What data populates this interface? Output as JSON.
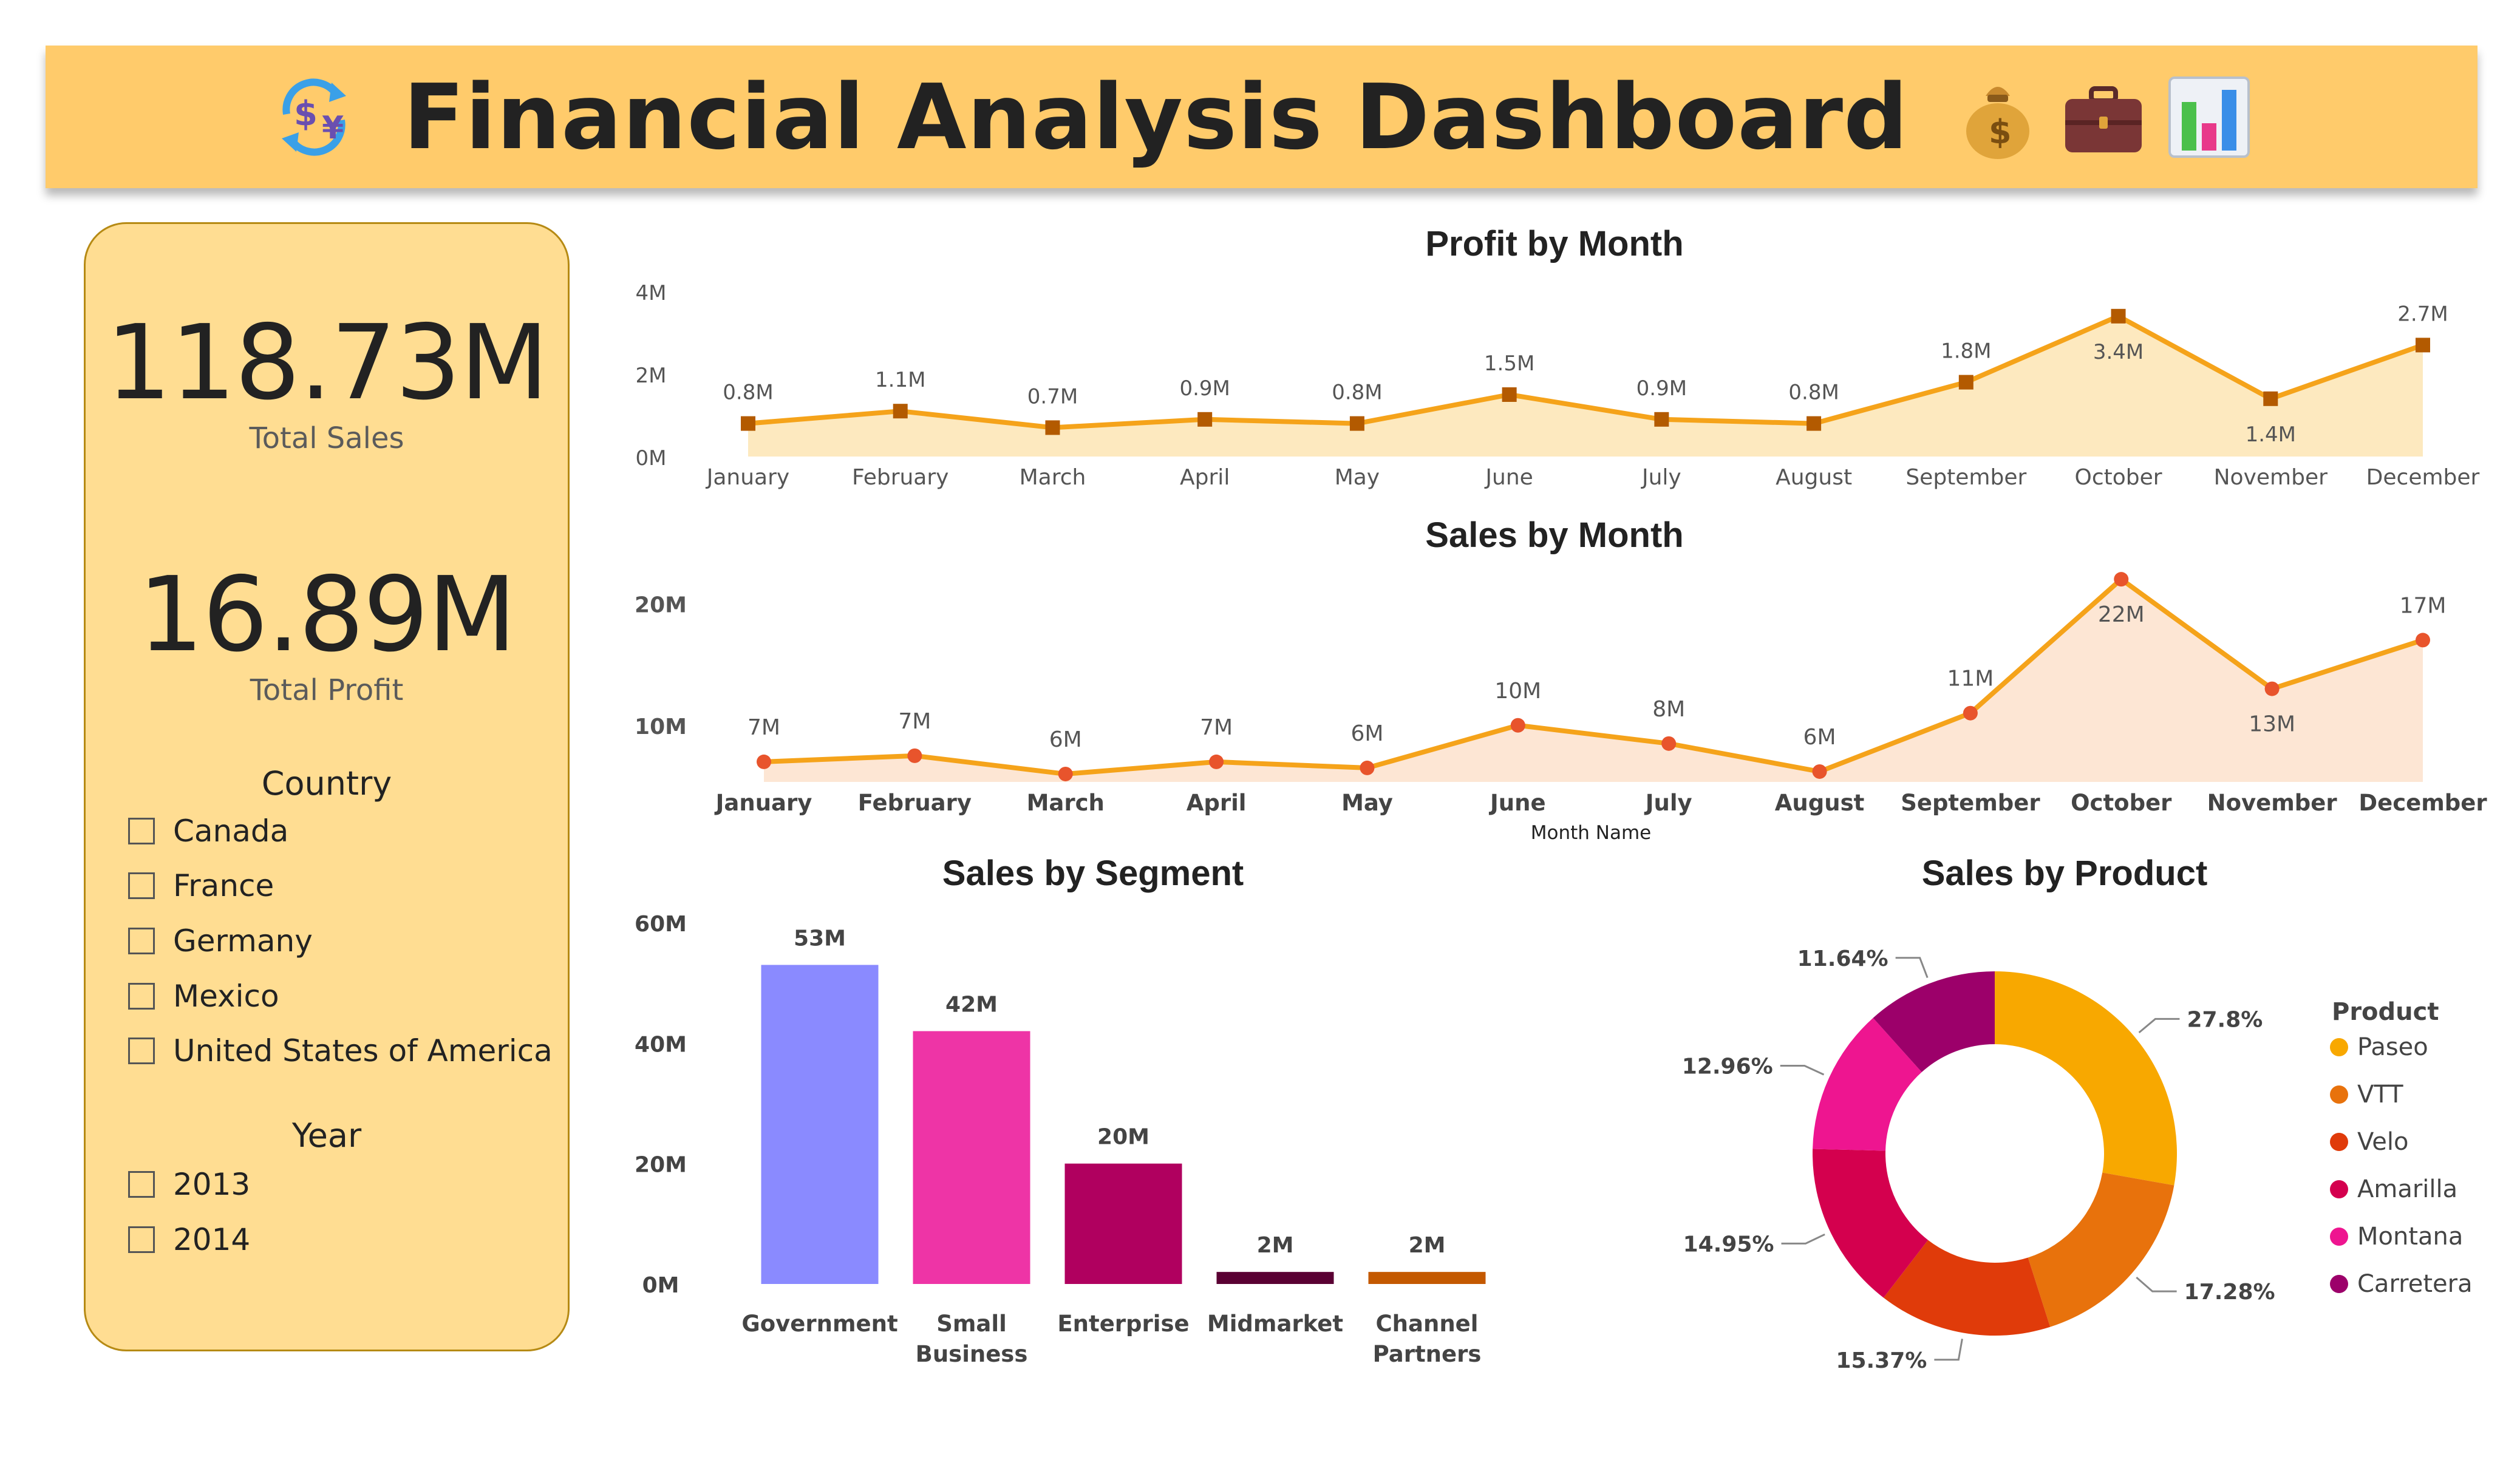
{
  "header": {
    "title": "Financial Analysis Dashboard",
    "icons": [
      "currency-exchange-icon",
      "money-bag-icon",
      "briefcase-icon",
      "bar-chart-icon"
    ]
  },
  "kpis": {
    "total_sales_value": "118.73M",
    "total_sales_label": "Total Sales",
    "total_profit_value": "16.89M",
    "total_profit_label": "Total Profit"
  },
  "slicers": {
    "country_title": "Country",
    "countries": [
      "Canada",
      "France",
      "Germany",
      "Mexico",
      "United States of America"
    ],
    "year_title": "Year",
    "years": [
      "2013",
      "2014"
    ]
  },
  "colors": {
    "header_bg": "#ffcb6b",
    "panel_bg": "#ffdd92",
    "line_orange": "#f5a31a",
    "profit_marker": "#b35a00",
    "sales_marker": "#e8542c"
  },
  "chart_data": [
    {
      "id": "profit_by_month",
      "type": "line",
      "title": "Profit by Month",
      "categories": [
        "January",
        "February",
        "March",
        "April",
        "May",
        "June",
        "July",
        "August",
        "September",
        "October",
        "November",
        "December"
      ],
      "values": [
        0.8,
        1.1,
        0.7,
        0.9,
        0.8,
        1.5,
        0.9,
        0.8,
        1.8,
        3.4,
        1.4,
        2.7
      ],
      "data_labels": [
        "0.8M",
        "1.1M",
        "0.7M",
        "0.9M",
        "0.8M",
        "1.5M",
        "0.9M",
        "0.8M",
        "1.8M",
        "3.4M",
        "1.4M",
        "2.7M"
      ],
      "y_ticks": [
        0,
        2,
        4
      ],
      "y_tick_labels": [
        "0M",
        "2M",
        "4M"
      ],
      "ylim": [
        0,
        4
      ],
      "unit": "M"
    },
    {
      "id": "sales_by_month",
      "type": "line",
      "title": "Sales by Month",
      "xlabel": "Month Name",
      "categories": [
        "January",
        "February",
        "March",
        "April",
        "May",
        "June",
        "July",
        "August",
        "September",
        "October",
        "November",
        "December"
      ],
      "values": [
        7,
        7.5,
        6,
        7,
        6.5,
        10,
        8.5,
        6.2,
        11,
        22,
        13,
        17
      ],
      "data_labels": [
        "7M",
        "7M",
        "6M",
        "7M",
        "6M",
        "10M",
        "8M",
        "6M",
        "11M",
        "22M",
        "13M",
        "17M"
      ],
      "y_ticks": [
        10,
        20
      ],
      "y_tick_labels": [
        "10M",
        "20M"
      ],
      "ylim": [
        5,
        25
      ],
      "unit": "M"
    },
    {
      "id": "sales_by_segment",
      "type": "bar",
      "title": "Sales by Segment",
      "categories": [
        "Government",
        "Small Business",
        "Enterprise",
        "Midmarket",
        "Channel Partners"
      ],
      "values": [
        53,
        42,
        20,
        2,
        2
      ],
      "data_labels": [
        "53M",
        "42M",
        "20M",
        "2M",
        "2M"
      ],
      "colors": [
        "#8a8aff",
        "#ee34a6",
        "#b0005f",
        "#5a0033",
        "#c45900"
      ],
      "y_ticks": [
        0,
        20,
        40,
        60
      ],
      "y_tick_labels": [
        "0M",
        "20M",
        "40M",
        "60M"
      ],
      "ylim": [
        0,
        60
      ]
    },
    {
      "id": "sales_by_product",
      "type": "pie",
      "title": "Sales by Product",
      "legend_title": "Product",
      "legend_position": "right",
      "slices": [
        {
          "name": "Paseo",
          "value": 27.8,
          "label": "27.8%",
          "color": "#f8a800"
        },
        {
          "name": "VTT",
          "value": 17.28,
          "label": "17.28%",
          "color": "#e8720c"
        },
        {
          "name": "Velo",
          "value": 15.37,
          "label": "15.37%",
          "color": "#e03b0a"
        },
        {
          "name": "Amarilla",
          "value": 14.95,
          "label": "14.95%",
          "color": "#d4004e"
        },
        {
          "name": "Montana",
          "value": 12.96,
          "label": "12.96%",
          "color": "#ee1590"
        },
        {
          "name": "Carretera",
          "value": 11.64,
          "label": "11.64%",
          "color": "#9c006a"
        }
      ]
    }
  ]
}
